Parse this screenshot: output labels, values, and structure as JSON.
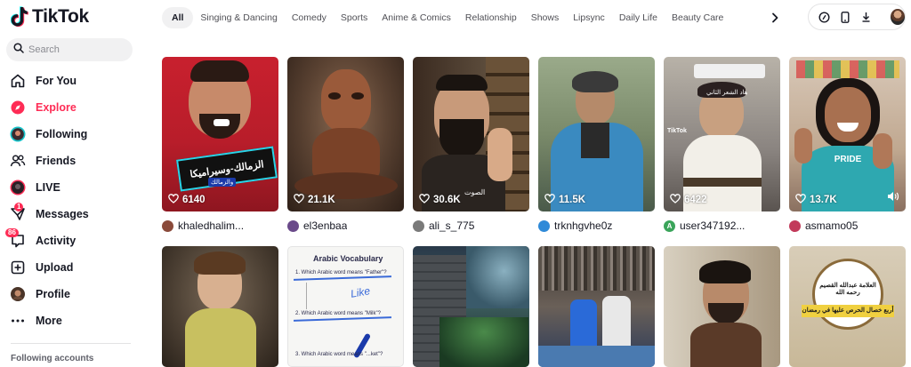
{
  "app": {
    "name": "TikTok"
  },
  "search": {
    "placeholder": "Search"
  },
  "nav": [
    {
      "label": "For You",
      "icon": "home-icon"
    },
    {
      "label": "Explore",
      "icon": "compass-icon",
      "active": true
    },
    {
      "label": "Following",
      "icon": "following-avatar-icon"
    },
    {
      "label": "Friends",
      "icon": "friends-icon"
    },
    {
      "label": "LIVE",
      "icon": "live-icon"
    },
    {
      "label": "Messages",
      "icon": "messages-icon",
      "badge": "1"
    },
    {
      "label": "Activity",
      "icon": "activity-icon",
      "badge": "86"
    },
    {
      "label": "Upload",
      "icon": "upload-icon"
    },
    {
      "label": "Profile",
      "icon": "profile-avatar-icon"
    },
    {
      "label": "More",
      "icon": "more-icon"
    }
  ],
  "sidebar_footer": {
    "following_accounts": "Following accounts"
  },
  "categories": [
    "All",
    "Singing & Dancing",
    "Comedy",
    "Sports",
    "Anime & Comics",
    "Relationship",
    "Shows",
    "Lipsync",
    "Daily Life",
    "Beauty Care"
  ],
  "active_category": "All",
  "toolbar": {
    "icons": [
      "coin-icon",
      "phone-icon",
      "download-icon",
      "user-avatar"
    ]
  },
  "videos_row1": [
    {
      "views": "6140",
      "author": "khaledhalim...",
      "avatar_color": "#8a4a3a",
      "overlay_text": "الزمالك-وسيراميكا",
      "overlay_sub": "والزمالك"
    },
    {
      "views": "21.1K",
      "author": "el3enbaa",
      "avatar_color": "#6a4a8a"
    },
    {
      "views": "30.6K",
      "author": "ali_s_775",
      "avatar_color": "#7a7a7a",
      "overlay_text": "الصوت"
    },
    {
      "views": "11.5K",
      "author": "trknhgvhe0z",
      "avatar_color": "#2f8ad8"
    },
    {
      "views": "6422",
      "author": "user347192...",
      "avatar_color": "#3aa45a",
      "avatar_letter": "A",
      "overlay_text": "هاد الشعر الثاني",
      "watermark": "TikTok"
    },
    {
      "views": "13.7K",
      "author": "asmamo05",
      "avatar_color": "#c23a5a",
      "overlay_text": "PRIDE",
      "muted": true
    }
  ],
  "videos_row2": [
    {
      "id": "r2c1"
    },
    {
      "title": "Arabic Vocabulary",
      "q1": "1. Which Arabic word means \"Father\"?",
      "q2": "2. Which Arabic word means \"Milk\"?",
      "q3": "3. Which Arabic word means \"...ket\"?",
      "mark": "Like"
    },
    {
      "id": "r2c3"
    },
    {
      "id": "r2c4"
    },
    {
      "id": "r2c5"
    },
    {
      "overlay_top": "العلامة عبدالله القصيم رحمه الله",
      "overlay_bottom": "أربع خصال الحرص عليها في رمضان"
    }
  ],
  "colors": {
    "accent": "#fe2c55",
    "text": "#161823",
    "muted": "#8a8b91",
    "chip_bg": "#f1f1f2"
  }
}
